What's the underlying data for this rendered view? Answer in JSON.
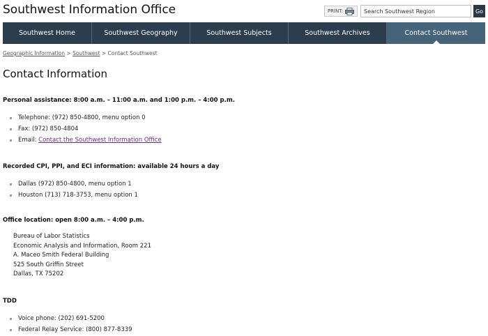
{
  "header": {
    "site_title": "Southwest Information Office",
    "print_label": "PRINT:",
    "print_icon": "printer-icon",
    "search_value": "Search Southwest Region",
    "go_label": "Go"
  },
  "nav": {
    "items": [
      {
        "label": "Southwest Home"
      },
      {
        "label": "Southwest Geography"
      },
      {
        "label": "Southwest Subjects"
      },
      {
        "label": "Southwest Archives"
      },
      {
        "label": "Contact Southwest"
      }
    ],
    "active": "Contact Southwest",
    "background": "#2c3e4e",
    "active_background": "#456379"
  },
  "breadcrumb": {
    "items": [
      "Geographic Information",
      "Southwest",
      "Contact Southwest"
    ],
    "separator": ">"
  },
  "page_title": "Contact Information",
  "sections": [
    {
      "heading": "Personal assistance: 8:00 a.m. – 11:00 a.m. and 1:00 p.m. – 4:00 p.m.",
      "items": [
        "Telephone: (972) 850-4800, menu option 0",
        "Fax: (972) 850-4804"
      ],
      "email_label": "Email: ",
      "email_link": "Contact the Southwest Information Office"
    },
    {
      "heading": "Recorded CPI, PPI, and ECI information: available 24 hours a day",
      "items": [
        "Dallas (972) 850-4800, menu option 1",
        "Houston (713) 718-3753, menu option 1"
      ]
    },
    {
      "heading": "Office location: open 8:00 a.m. – 4:00 p.m.",
      "address": [
        "Bureau of Labor Statistics",
        "Economic Analysis and Information, Room 221",
        "A. Maceo Smith Federal Building",
        "525 South Griffin Street",
        "Dallas, TX 75202"
      ]
    },
    {
      "heading": "TDD",
      "items": [
        "Voice phone: (202) 691-5200",
        "Federal Relay Service: (800) 877-8339"
      ]
    }
  ],
  "colors": {
    "link": "#6a2c8c",
    "bullet": "#9a9a9a"
  }
}
